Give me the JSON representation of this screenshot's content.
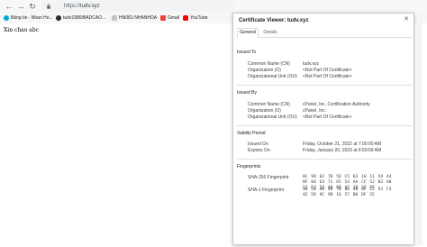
{
  "browser": {
    "url_scheme": "https://",
    "url_host": "tudv.xyz",
    "bookmarks": [
      {
        "label": "Bảng tin - Nhan Ho..."
      },
      {
        "label": "tudv1986/BADCAO..."
      },
      {
        "label": "HN081-NHANHOA"
      },
      {
        "label": "Gmail"
      },
      {
        "label": "YouTube"
      }
    ]
  },
  "page": {
    "body_text": "Xin chao abc"
  },
  "dialog": {
    "title": "Certificate Viewer: tudv.xyz",
    "tabs": [
      "General",
      "Details"
    ],
    "issued_to": {
      "heading": "Issued To",
      "rows": [
        {
          "label": "Common Name (CN)",
          "value": "tudv.xyz"
        },
        {
          "label": "Organization (O)",
          "value": "<Not Part Of Certificate>"
        },
        {
          "label": "Organizational Unit (OU)",
          "value": "<Not Part Of Certificate>"
        }
      ]
    },
    "issued_by": {
      "heading": "Issued By",
      "rows": [
        {
          "label": "Common Name (CN)",
          "value": "cPanel, Inc. Certification Authority"
        },
        {
          "label": "Organization (O)",
          "value": "cPanel, Inc."
        },
        {
          "label": "Organizational Unit (OU)",
          "value": "<Not Part Of Certificate>"
        }
      ]
    },
    "validity": {
      "heading": "Validity Period",
      "rows": [
        {
          "label": "Issued On",
          "value": "Friday, October 21, 2022 at 7:00:00 AM"
        },
        {
          "label": "Expires On",
          "value": "Friday, January 20, 2023 at 6:59:59 AM"
        }
      ]
    },
    "fingerprints": {
      "heading": "Fingerprints",
      "rows": [
        {
          "label": "SHA-256 Fingerprint",
          "value": "0C 98 02 78 58 C5 83 18 11 5A 44 8F 84 E4 71 65 54 AA CF 52 B2 A8 21 F3 53 AD FD 47 18 32 FF"
        },
        {
          "label": "SHA-1 Fingerprint",
          "value": "36 58 4D 40 70 86 A8 8F 22 91 F3 4E 58 9C 9B 16 57 B0 DF CE"
        }
      ]
    }
  },
  "colors": {
    "gmail": "#ea4335",
    "youtube": "#ff0000",
    "github": "#24292e",
    "folder": "#5f6368"
  }
}
